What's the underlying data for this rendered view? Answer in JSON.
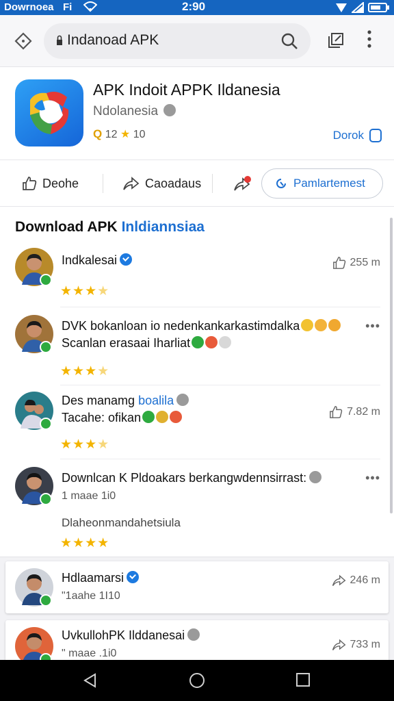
{
  "status_bar": {
    "left_text": "Dowrnoea",
    "sim_text": "Fi",
    "time": "2:90"
  },
  "url_bar": {
    "url_text": "Indanoad APK"
  },
  "app": {
    "title": "APK Indoit APPK Ildanesia",
    "subtitle": "Ndolanesia",
    "rating_q": "Q",
    "rating_count": "12",
    "rating_value": "10",
    "download_label": "Dorok"
  },
  "actions": {
    "like_label": "Deohe",
    "share_label": "Caoadaus",
    "pill_label": "Pamlartemest"
  },
  "section": {
    "title_plain": "Download APK",
    "title_highlight": "Inldiannsiaa"
  },
  "reviews": [
    {
      "name": "Indkalesai",
      "count": "255 m",
      "stars_filled": "★★★",
      "stars_dim": "★"
    },
    {
      "line1": "DVK bokanloan io nedenkankarkastimdalka",
      "line2": "Scanlan erasaai Iharliat",
      "stars_filled": "★★★",
      "stars_dim": "★"
    },
    {
      "name_plain": "Des manamg",
      "name_blue": "boalila",
      "line2": "Tacahe: ofikan",
      "count": "7.82 m",
      "stars_filled": "★★★",
      "stars_dim": "★"
    },
    {
      "line1": "Downlcan K Pldoakars berkangwdennsirrast:",
      "meta": "1 maae  1i0",
      "extra": "Dlaheonmandahetsiula",
      "stars_filled": "★★★★",
      "stars_dim": ""
    }
  ],
  "mini_cards": [
    {
      "name": "Hdlaamarsi",
      "meta": "\"1aahe 1I10",
      "count": "246 m"
    },
    {
      "name": "UvkullohPK Ilddanesai",
      "meta": "\" maae .1i0",
      "count": "733 m"
    }
  ],
  "colors": {
    "status_bar": "#1565c0",
    "accent": "#1d6fd1",
    "star": "#f3b400",
    "verified_badge": "#2eaa3f"
  }
}
